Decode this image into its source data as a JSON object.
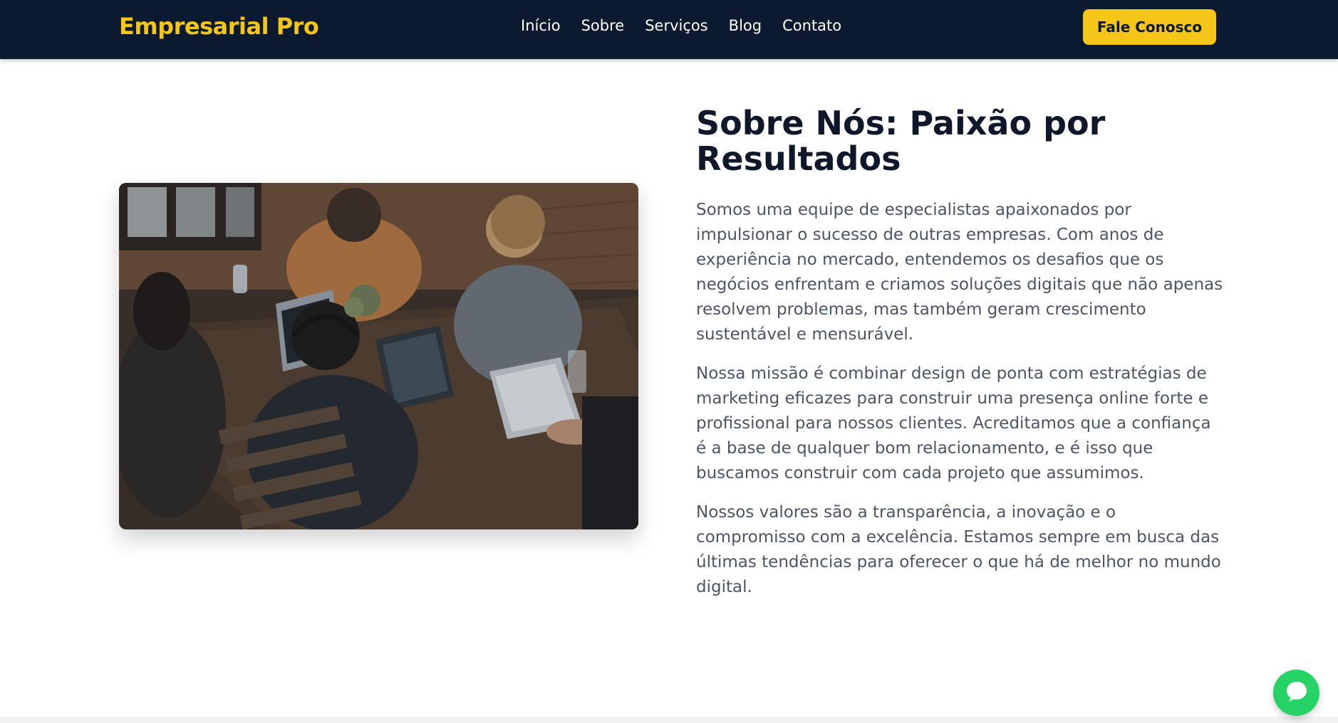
{
  "header": {
    "brand": "Empresarial Pro",
    "nav": [
      {
        "label": "Início"
      },
      {
        "label": "Sobre"
      },
      {
        "label": "Serviços"
      },
      {
        "label": "Blog"
      },
      {
        "label": "Contato"
      }
    ],
    "cta_label": "Fale Conosco"
  },
  "about": {
    "heading": "Sobre Nós: Paixão por Resultados",
    "paragraphs": [
      "Somos uma equipe de especialistas apaixonados por impulsionar o sucesso de outras empresas. Com anos de experiência no mercado, entendemos os desafios que os negócios enfrentam e criamos soluções digitais que não apenas resolvem problemas, mas também geram crescimento sustentável e mensurável.",
      "Nossa missão é combinar design de ponta com estratégias de marketing eficazes para construir uma presença online forte e profissional para nossos clientes. Acreditamos que a confiança é a base de qualquer bom relacionamento, e é isso que buscamos construir com cada projeto que assumimos.",
      "Nossos valores são a transparência, a inovação e o compromisso com a excelência. Estamos sempre em busca das últimas tendências para oferecer o que há de melhor no mundo digital."
    ]
  },
  "colors": {
    "nav_bg": "#0b1a2e",
    "accent": "#f5c518",
    "heading": "#0f172a",
    "body_text": "#4b5563",
    "chat_green": "#25d366"
  },
  "icons": {
    "chat": "chat-bubble-icon"
  }
}
